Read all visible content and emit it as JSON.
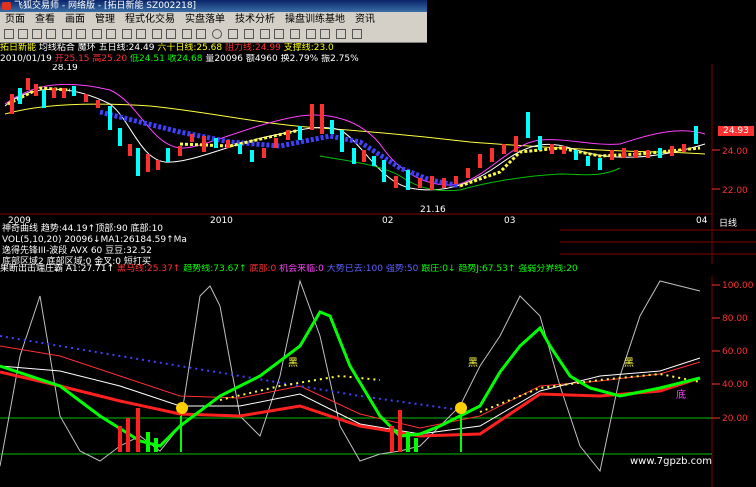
{
  "window": {
    "title": "飞狐交易师 - 网络版 - [拓日新能 SZ002218]"
  },
  "menu": [
    "页面",
    "查看",
    "画面",
    "管理",
    "程式化交易",
    "实盘落单",
    "技术分析",
    "操盘训练基地",
    "资讯"
  ],
  "header": {
    "stock": "拓日新能",
    "indicator": "均线粘合 魔环",
    "ma5": "五日线:24.49",
    "ma60": "六十日线:25.68",
    "resistance": "阻力线:24.99",
    "support": "支撑线:23.0",
    "date": "2010/01/19",
    "open": "开25.15",
    "high": "高25.20",
    "low": "低24.51",
    "close": "收24.68",
    "volume": "量20096",
    "amount": "额4960",
    "turnover": "换2.79%",
    "amplitude": "振2.75%"
  },
  "price_chart": {
    "hi_label": "28.19",
    "lo_label": "21.16",
    "y_ticks": [
      "24.00",
      "22.00"
    ],
    "current_price": "24.93",
    "x_ticks": [
      "2009",
      "2010",
      "02",
      "03",
      "04"
    ]
  },
  "info_panel": {
    "line1": "神奇曲线 趋势:44.19↑顶部:90 底部:10",
    "line2": "VOL(5,10,20) 20096↓MA1:26184.59↑Ma",
    "line3": "逸得先锋III-波段 AVX 60 豆豆:32.52",
    "line4": "底部区域2 底部区域:0 金叉:0 短打买",
    "right_label": "日线"
  },
  "indicator_header": {
    "name": "果断出击端庄霸",
    "a1": "A1:27.71↑",
    "heima": "黑马线:25.37↑",
    "qushi": "趋势线:73.67↑",
    "dibu": "底部:0",
    "jihui": "机会来临:0",
    "dayan": "大势已去:100",
    "qiangshi": "强势:50",
    "genzhuang": "跟庄:0↓",
    "qushi_j": "趋势J:67.53↑",
    "jiexian": "强弱分界线:20"
  },
  "indicator_chart": {
    "y_ticks": [
      "100.00",
      "80.00",
      "60.00",
      "40.00",
      "20.00"
    ],
    "labels": [
      "黑",
      "黑",
      "黑",
      "底"
    ]
  },
  "watermark": "www.7gpzb.com",
  "colors": {
    "bg": "#000000",
    "up": "#ff3030",
    "down": "#00ffff",
    "ma_yellow": "#ffff40",
    "ma_magenta": "#ff40ff",
    "ma_white": "#ffffff",
    "grid": "#800000"
  }
}
